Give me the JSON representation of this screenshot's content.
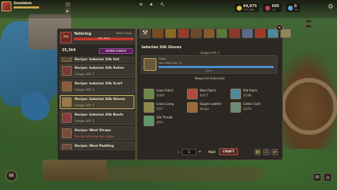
{
  "player": {
    "name": "Smoldsm",
    "level_progress": 0.7
  },
  "hud": {
    "gold": "69,075",
    "gold_rate": "+27,900",
    "gems": "695",
    "gems_rate": "+0",
    "premium": "0",
    "premium_rate": "+0"
  },
  "side_buttons": [
    "",
    ""
  ],
  "tailoring": {
    "title": "Tailoring",
    "right_label": "Tailor's Shop",
    "bar_label": "Max Rank",
    "bar_fill": 1.0,
    "level_label": "",
    "points": "25,364",
    "spend_label": "SPEND POINTS"
  },
  "recipes": [
    {
      "name": "Recipe: Iadurian Silk Hat",
      "sub": "",
      "cut": true
    },
    {
      "name": "Recipe: Iadurian Silk Robes",
      "sub": "Usages left: 5"
    },
    {
      "name": "Recipe: Iadurian Silk Scarf",
      "sub": "Usages left: 4"
    },
    {
      "name": "Recipe: Iadurian Silk Gloves",
      "sub": "Usages left: 1",
      "selected": true
    },
    {
      "name": "Recipe: Iadurian Silk Boots",
      "sub": "Usages left: 3"
    },
    {
      "name": "Recipe: Wool Straps",
      "sub": "You do not know this recipe",
      "red": true
    },
    {
      "name": "Recipe: Wool Padding",
      "sub": "",
      "cut": true
    }
  ],
  "detail": {
    "title": "Iadurian Silk Gloves",
    "usages": "Usages left: 1",
    "card_line1": "Glove",
    "card_line2": "Max batch size: 10",
    "progress": 1.0,
    "done_label": "Done",
    "required_title": "Required materials"
  },
  "materials": [
    {
      "name": "Linen Fabric",
      "qty": "3/307",
      "color": "#6a8a4a"
    },
    {
      "name": "Wool Fabric",
      "qty": "4/217",
      "color": "#b04a3a"
    },
    {
      "name": "Silk Fabric",
      "qty": "4/190",
      "color": "#4a8a9a"
    },
    {
      "name": "Linen Lining",
      "qty": "5/27",
      "color": "#8a8a4a"
    },
    {
      "name": "Supple Leather",
      "qty": "Straps",
      "color": "#9a6a3a"
    },
    {
      "name": "Cotton Cord",
      "qty": "3/153",
      "color": "#6a8a7a"
    },
    {
      "name": "Silk Thread",
      "qty": "4/54",
      "color": "#5a9a6a"
    }
  ],
  "craft": {
    "minus": "−",
    "qty": "1",
    "plus": "+",
    "max_label": "MAX",
    "craft_label": "CRAFT"
  },
  "colors": {
    "accent_red": "#c0372c",
    "accent_purple": "#5a1e5c",
    "selected_border": "#d8c070"
  }
}
